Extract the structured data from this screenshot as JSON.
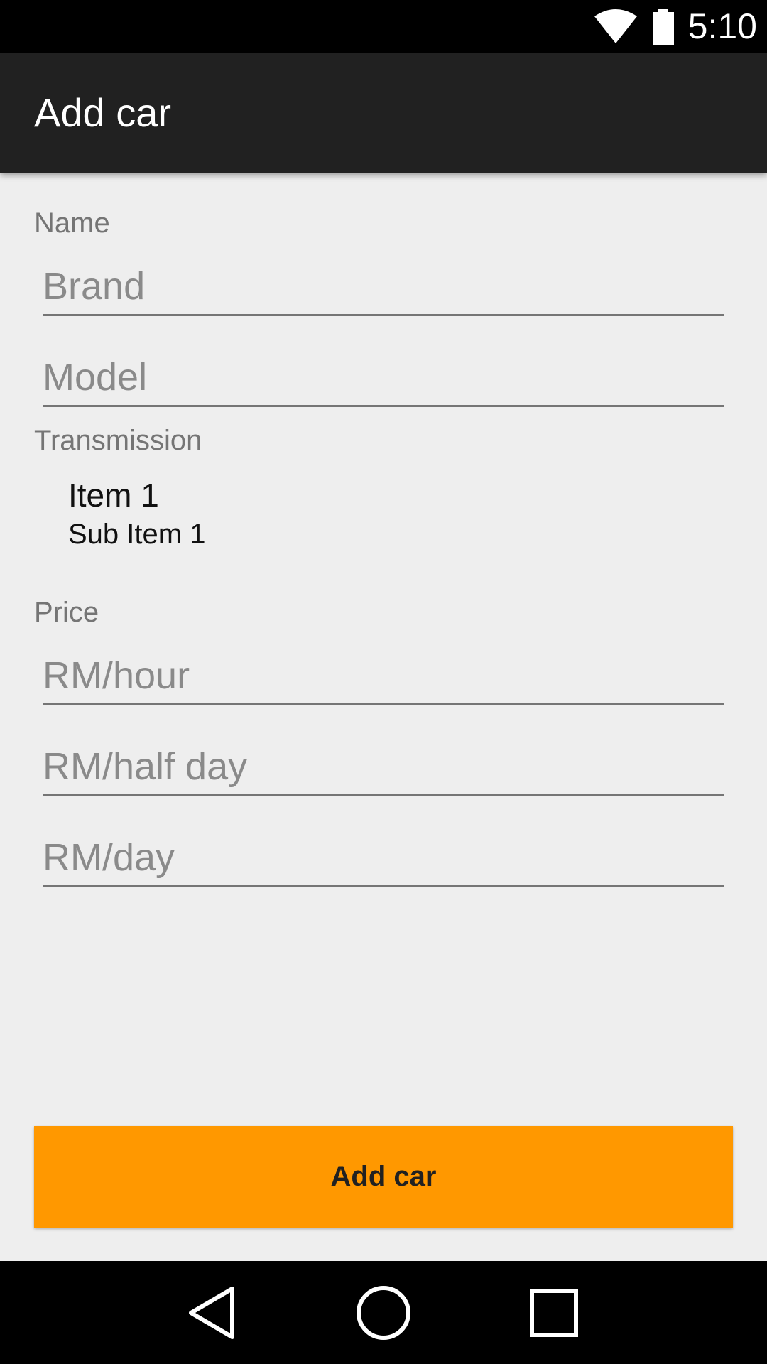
{
  "status_bar": {
    "time": "5:10",
    "icons": [
      "wifi-icon",
      "battery-icon"
    ]
  },
  "app_bar": {
    "title": "Add car",
    "background": "#212121"
  },
  "form": {
    "name_section": {
      "label": "Name",
      "brand_placeholder": "Brand",
      "model_placeholder": "Model"
    },
    "transmission_section": {
      "label": "Transmission",
      "selected_item": "Item 1",
      "selected_sub_item": "Sub Item 1"
    },
    "price_section": {
      "label": "Price",
      "hour_placeholder": "RM/hour",
      "half_day_placeholder": "RM/half day",
      "day_placeholder": "RM/day"
    }
  },
  "submit_button": {
    "label": "Add car",
    "color": "#ff9800"
  },
  "nav_bar": {
    "icons": [
      "back-icon",
      "home-icon",
      "recents-icon"
    ]
  }
}
